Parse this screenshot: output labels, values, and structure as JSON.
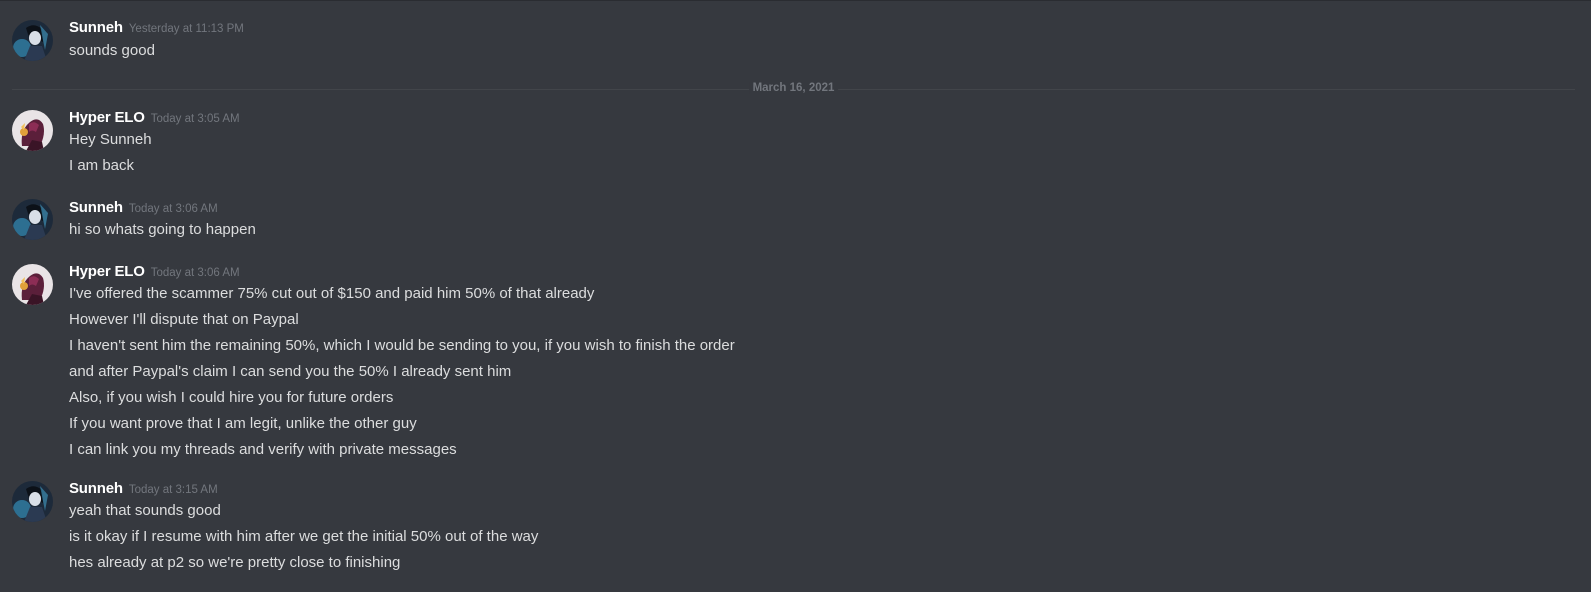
{
  "date_divider": "March 16, 2021",
  "groups": [
    {
      "username": "Sunneh",
      "timestamp": "Yesterday at 11:13 PM",
      "avatar_icon": "sunneh-avatar-icon",
      "lines": [
        "sounds good"
      ]
    },
    {
      "username": "Hyper ELO",
      "timestamp": "Today at 3:05 AM",
      "avatar_icon": "hyper-elo-avatar-icon",
      "lines": [
        "Hey Sunneh",
        "I am back"
      ]
    },
    {
      "username": "Sunneh",
      "timestamp": "Today at 3:06 AM",
      "avatar_icon": "sunneh-avatar-icon",
      "lines": [
        "hi so whats going to happen"
      ]
    },
    {
      "username": "Hyper ELO",
      "timestamp": "Today at 3:06 AM",
      "avatar_icon": "hyper-elo-avatar-icon",
      "lines": [
        "I've offered the scammer 75% cut out of $150 and paid him 50% of that already",
        "However I'll dispute that on Paypal",
        "I haven't sent him the remaining 50%, which I would be sending to you, if you wish to finish the order",
        "and after Paypal's claim I can send you the 50% I already sent him",
        "Also, if you wish I could hire you for future orders",
        "If you want prove that I am legit, unlike the other guy",
        "I can link you my threads and verify with private messages"
      ]
    },
    {
      "username": "Sunneh",
      "timestamp": "Today at 3:15 AM",
      "avatar_icon": "sunneh-avatar-icon",
      "lines": [
        "yeah that sounds good",
        "is it okay if I resume with him after we get the initial 50% out of the way",
        "hes already at p2 so we're pretty close to finishing"
      ]
    }
  ]
}
